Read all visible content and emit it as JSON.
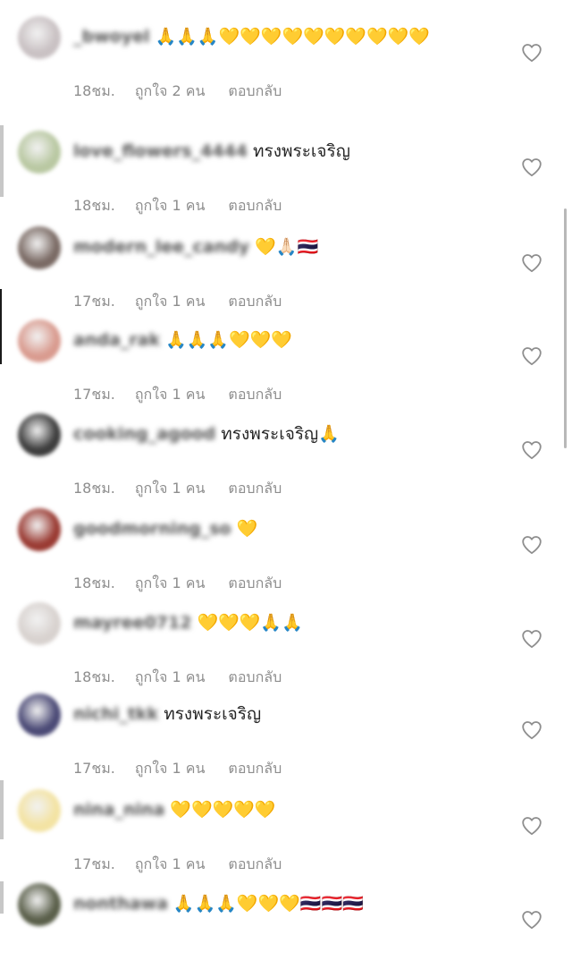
{
  "comments": [
    {
      "username": "_bwoyel",
      "text": "🙏🙏🙏💛💛💛💛💛💛💛💛💛💛",
      "time": "18ชม.",
      "likes": "ถูกใจ 2 คน",
      "reply": "ตอบกลับ",
      "avatar_color": "#c9c1c3"
    },
    {
      "username": "love_flowers_4444",
      "text": "ทรงพระเจริญ",
      "time": "18ชม.",
      "likes": "ถูกใจ 1 คน",
      "reply": "ตอบกลับ",
      "avatar_color": "#b9c8a2"
    },
    {
      "username": "modern_lee_candy",
      "text": "💛🙏🏻🇹🇭",
      "time": "17ชม.",
      "likes": "ถูกใจ 1 คน",
      "reply": "ตอบกลับ",
      "avatar_color": "#7a6a64"
    },
    {
      "username": "anda_rak",
      "text": "🙏🙏🙏💛💛💛",
      "time": "17ชม.",
      "likes": "ถูกใจ 1 คน",
      "reply": "ตอบกลับ",
      "avatar_color": "#d99b8f"
    },
    {
      "username": "cooking_agood",
      "text": "ทรงพระเจริญ🙏",
      "time": "18ชม.",
      "likes": "ถูกใจ 1 คน",
      "reply": "ตอบกลับ",
      "avatar_color": "#3d3d3d"
    },
    {
      "username": "goodmorning_so",
      "text": "💛",
      "time": "18ชม.",
      "likes": "ถูกใจ 1 คน",
      "reply": "ตอบกลับ",
      "avatar_color": "#9a3b33"
    },
    {
      "username": "mayree0712",
      "text": "💛💛💛🙏🙏",
      "time": "18ชม.",
      "likes": "ถูกใจ 1 คน",
      "reply": "ตอบกลับ",
      "avatar_color": "#d8d2cf"
    },
    {
      "username": "nichi_tkk",
      "text": "ทรงพระเจริญ",
      "time": "17ชม.",
      "likes": "ถูกใจ 1 คน",
      "reply": "ตอบกลับ",
      "avatar_color": "#4b4a76"
    },
    {
      "username": "nina_nina",
      "text": "💛💛💛💛💛",
      "time": "17ชม.",
      "likes": "ถูกใจ 1 คน",
      "reply": "ตอบกลับ",
      "avatar_color": "#f3e3a3"
    },
    {
      "username": "nonthawa",
      "text": "🙏🙏🙏💛💛💛🇹🇭🇹🇭🇹🇭",
      "time": "",
      "likes": "",
      "reply": "",
      "avatar_color": "#5a5f4a"
    }
  ],
  "colors": {
    "text": "#262626",
    "meta": "#8e8e8e",
    "heart": "#8e8e8e"
  },
  "icons": {
    "like": "heart-outline-icon"
  }
}
